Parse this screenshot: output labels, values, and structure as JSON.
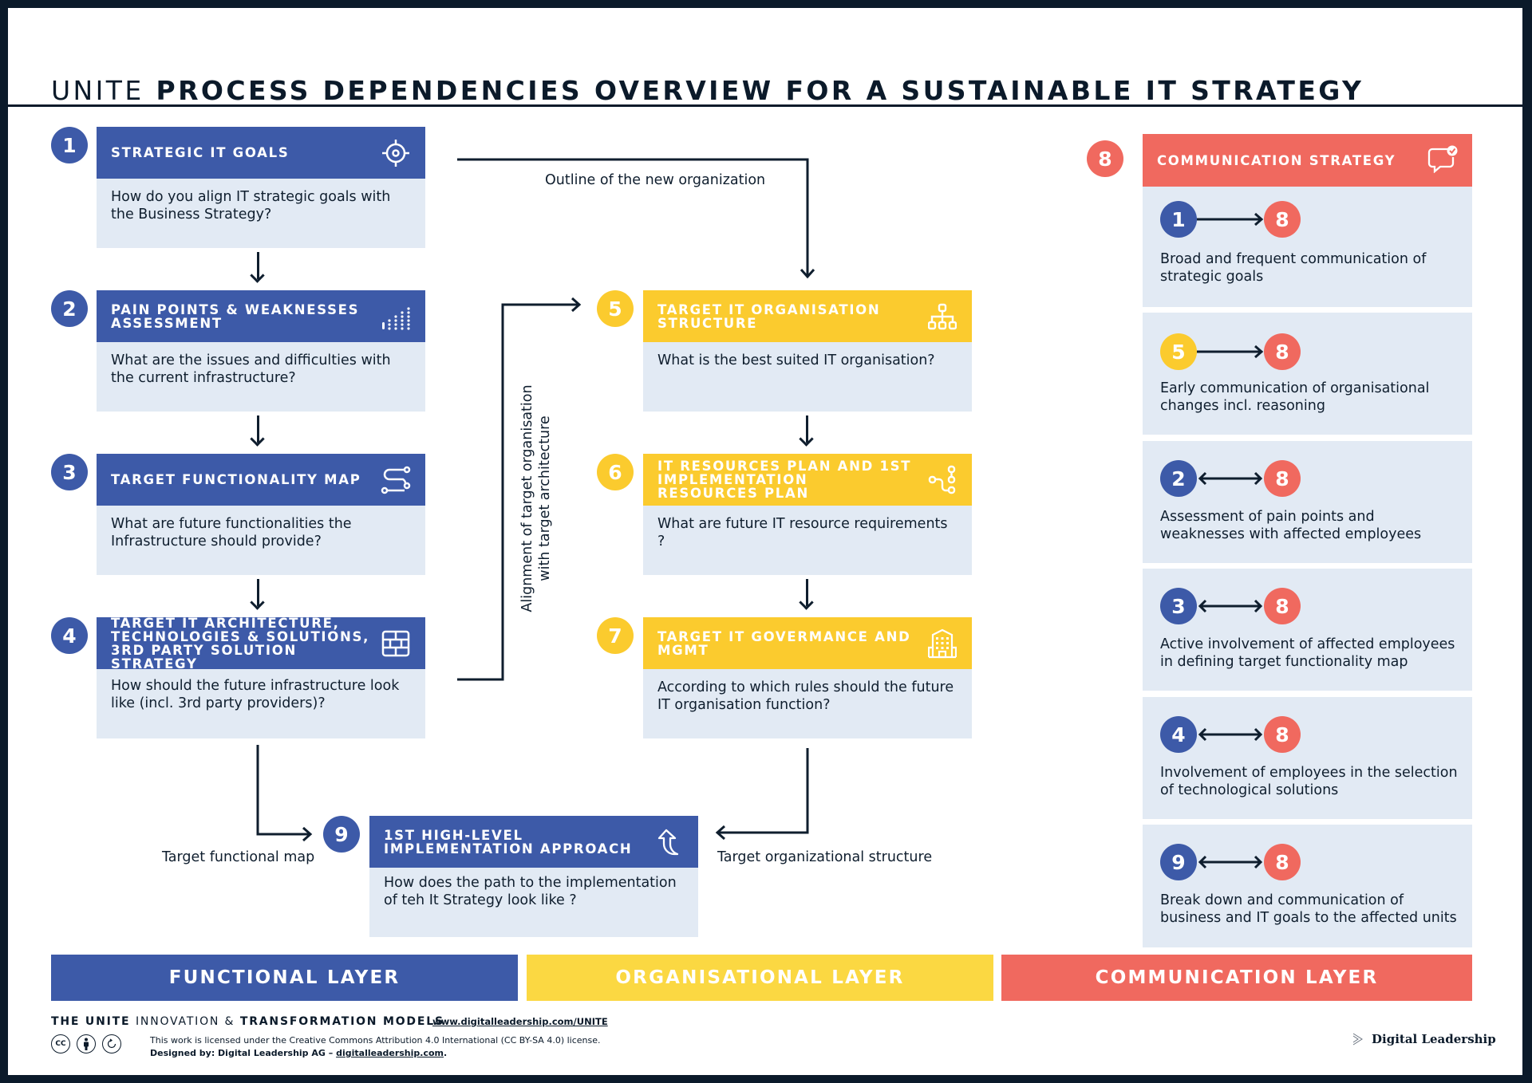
{
  "title": {
    "light": "UNITE",
    "bold": "PROCESS DEPENDENCIES OVERVIEW FOR A SUSTAINABLE IT STRATEGY"
  },
  "colors": {
    "functional": "#3d5aa8",
    "organisational": "#fbcb2e",
    "communication": "#f0695f",
    "card_body": "#e2eaf4",
    "ink": "#0b1a2a"
  },
  "steps": [
    {
      "num": "1",
      "title": "STRATEGIC IT GOALS",
      "question": "How do you align IT strategic goals with the Business Strategy?",
      "icon": "target-icon",
      "layer": "functional"
    },
    {
      "num": "2",
      "title": "PAIN POINTS & WEAKNESSES ASSESSMENT",
      "question": "What are the issues and difficulties with the current infrastructure?",
      "icon": "dot-bars-icon",
      "layer": "functional"
    },
    {
      "num": "3",
      "title": "TARGET FUNCTIONALITY MAP",
      "question": "What are future functionalities the Infrastructure should provide?",
      "icon": "route-icon",
      "layer": "functional"
    },
    {
      "num": "4",
      "title": "TARGET IT ARCHITECTURE, TECHNOLOGIES & SOLUTIONS, 3RD PARTY SOLUTION STRATEGY",
      "question": "How should the future infrastructure look like (incl. 3rd party providers)?",
      "icon": "brick-wall-icon",
      "layer": "functional"
    },
    {
      "num": "5",
      "title": "TARGET IT ORGANISATION STRUCTURE",
      "question": "What is the best suited IT organisation?",
      "icon": "org-chart-icon",
      "layer": "organisational"
    },
    {
      "num": "6",
      "title": "IT RESOURCES PLAN AND 1ST IMPLEMENTATION RESOURCES PLAN",
      "question": "What are future IT resource requirements ?",
      "icon": "nodes-icon",
      "layer": "organisational"
    },
    {
      "num": "7",
      "title": "TARGET IT GOVERMANCE AND MGMT",
      "question": "According to which rules should the future IT organisation function?",
      "icon": "building-icon",
      "layer": "organisational"
    },
    {
      "num": "9",
      "title": "1ST HIGH-LEVEL IMPLEMENTATION APPROACH",
      "question": "How does the path to the implementation of teh It Strategy look like ?",
      "icon": "curved-arrow-up-icon",
      "layer": "functional"
    }
  ],
  "connectors": {
    "outline": "Outline of the new organization",
    "alignment_line1": "Alignment of target organisation",
    "alignment_line2": "with target architecture",
    "functional_map": "Target functional map",
    "org_structure": "Target organizational structure"
  },
  "communication": {
    "num": "8",
    "title": "COMMUNICATION STRATEGY",
    "icon": "chat-check-icon",
    "items": [
      {
        "from": "1",
        "from_layer": "functional",
        "to": "8",
        "direction": "one-way",
        "text": "Broad and frequent communication of strategic goals"
      },
      {
        "from": "5",
        "from_layer": "organisational",
        "to": "8",
        "direction": "one-way",
        "text": "Early communication of organisational changes incl. reasoning"
      },
      {
        "from": "2",
        "from_layer": "functional",
        "to": "8",
        "direction": "two-way",
        "text": "Assessment of pain points and weaknesses with affected employees"
      },
      {
        "from": "3",
        "from_layer": "functional",
        "to": "8",
        "direction": "two-way",
        "text": "Active involvement of affected employees in defining target functionality map"
      },
      {
        "from": "4",
        "from_layer": "functional",
        "to": "8",
        "direction": "two-way",
        "text": "Involvement of employees in the selection of technological solutions"
      },
      {
        "from": "9",
        "from_layer": "functional",
        "to": "8",
        "direction": "two-way",
        "text": "Break down and communication of business and IT goals to the affected units"
      }
    ]
  },
  "layers": [
    {
      "label": "FUNCTIONAL LAYER"
    },
    {
      "label": "ORGANISATIONAL LAYER"
    },
    {
      "label": "COMMUNICATION LAYER"
    }
  ],
  "footer": {
    "series_bold1": "THE UNITE",
    "series_light": "INNOVATION &",
    "series_bold2": "TRANSFORMATION MODELS",
    "link": "www.digitalleadership.com/UNITE",
    "license": "This work is licensed under the Creative Commons Attribution 4.0 International (CC BY-SA 4.0) license.",
    "designed_prefix": "Designed by: Digital Leadership AG – ",
    "designed_link": "digitalleadership.com",
    "designed_suffix": ".",
    "cc_icons": [
      "cc-icon",
      "attribution-icon",
      "share-alike-icon"
    ],
    "cc_label": "CC",
    "brand": "Digital Leadership"
  }
}
